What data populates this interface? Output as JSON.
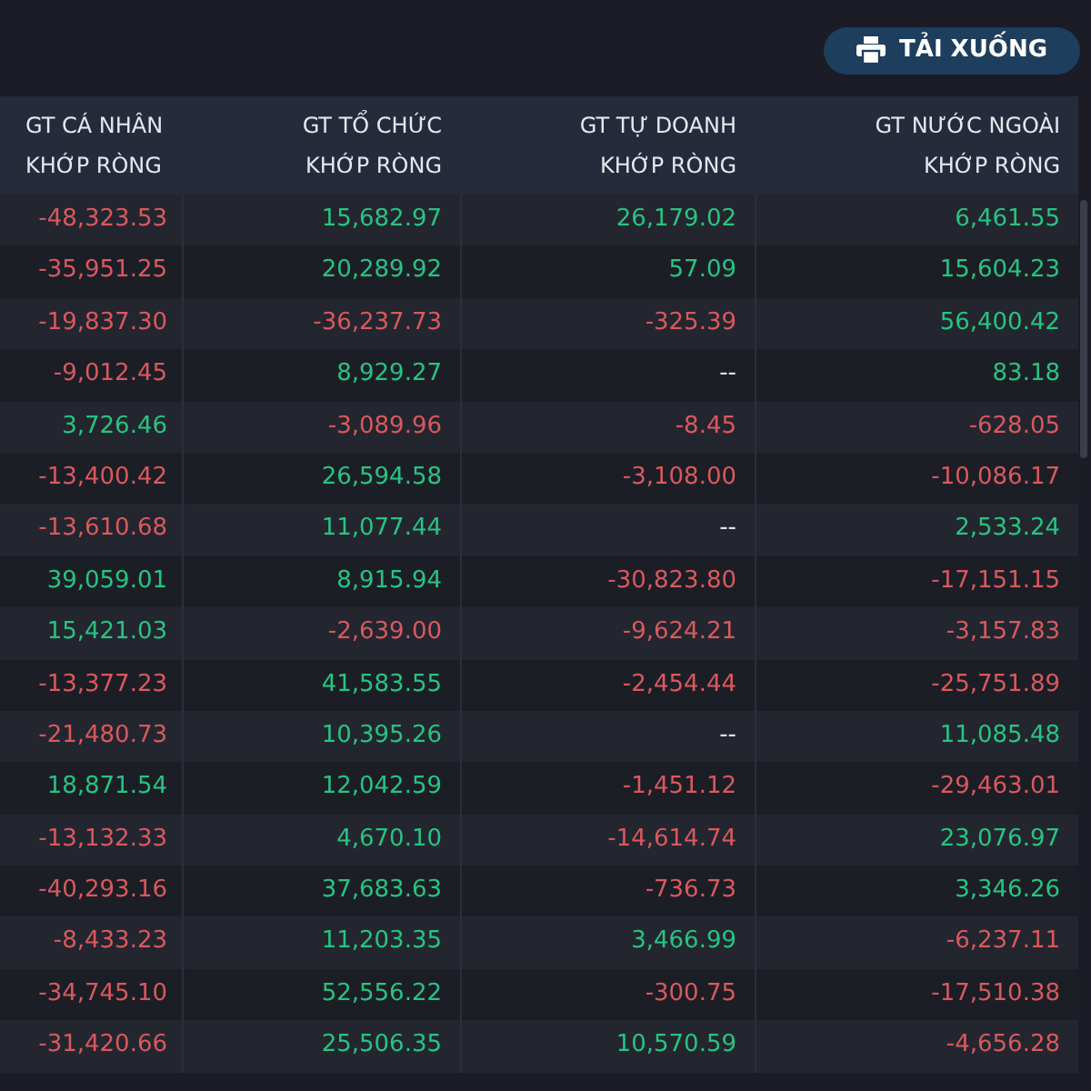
{
  "download_button": {
    "label": "TẢI XUỐNG"
  },
  "table": {
    "columns": [
      {
        "line1": "GT CÁ NHÂN",
        "line2": "KHỚP RÒNG"
      },
      {
        "line1": "GT TỔ CHỨC",
        "line2": "KHỚP RÒNG"
      },
      {
        "line1": "GT TỰ DOANH",
        "line2": "KHỚP RÒNG"
      },
      {
        "line1": "GT NƯỚC NGOÀI",
        "line2": "KHỚP RÒNG"
      }
    ],
    "rows": [
      [
        {
          "value": "-48,323.53",
          "color": "#d9595e"
        },
        {
          "value": "15,682.97",
          "color": "#27c481"
        },
        {
          "value": "26,179.02",
          "color": "#27c481"
        },
        {
          "value": "6,461.55",
          "color": "#27c481"
        }
      ],
      [
        {
          "value": "-35,951.25",
          "color": "#d9595e"
        },
        {
          "value": "20,289.92",
          "color": "#27c481"
        },
        {
          "value": "57.09",
          "color": "#27c481"
        },
        {
          "value": "15,604.23",
          "color": "#27c481"
        }
      ],
      [
        {
          "value": "-19,837.30",
          "color": "#d9595e"
        },
        {
          "value": "-36,237.73",
          "color": "#d9595e"
        },
        {
          "value": "-325.39",
          "color": "#d9595e"
        },
        {
          "value": "56,400.42",
          "color": "#27c481"
        }
      ],
      [
        {
          "value": "-9,012.45",
          "color": "#d9595e"
        },
        {
          "value": "8,929.27",
          "color": "#27c481"
        },
        {
          "value": "--",
          "color": "#e6e8ee"
        },
        {
          "value": "83.18",
          "color": "#27c481"
        }
      ],
      [
        {
          "value": "3,726.46",
          "color": "#27c481"
        },
        {
          "value": "-3,089.96",
          "color": "#d9595e"
        },
        {
          "value": "-8.45",
          "color": "#d9595e"
        },
        {
          "value": "-628.05",
          "color": "#d9595e"
        }
      ],
      [
        {
          "value": "-13,400.42",
          "color": "#d9595e"
        },
        {
          "value": "26,594.58",
          "color": "#27c481"
        },
        {
          "value": "-3,108.00",
          "color": "#d9595e"
        },
        {
          "value": "-10,086.17",
          "color": "#d9595e"
        }
      ],
      [
        {
          "value": "-13,610.68",
          "color": "#d9595e"
        },
        {
          "value": "11,077.44",
          "color": "#27c481"
        },
        {
          "value": "--",
          "color": "#e6e8ee"
        },
        {
          "value": "2,533.24",
          "color": "#27c481"
        }
      ],
      [
        {
          "value": "39,059.01",
          "color": "#27c481"
        },
        {
          "value": "8,915.94",
          "color": "#27c481"
        },
        {
          "value": "-30,823.80",
          "color": "#d9595e"
        },
        {
          "value": "-17,151.15",
          "color": "#d9595e"
        }
      ],
      [
        {
          "value": "15,421.03",
          "color": "#27c481"
        },
        {
          "value": "-2,639.00",
          "color": "#d9595e"
        },
        {
          "value": "-9,624.21",
          "color": "#d9595e"
        },
        {
          "value": "-3,157.83",
          "color": "#d9595e"
        }
      ],
      [
        {
          "value": "-13,377.23",
          "color": "#d9595e"
        },
        {
          "value": "41,583.55",
          "color": "#27c481"
        },
        {
          "value": "-2,454.44",
          "color": "#d9595e"
        },
        {
          "value": "-25,751.89",
          "color": "#d9595e"
        }
      ],
      [
        {
          "value": "-21,480.73",
          "color": "#d9595e"
        },
        {
          "value": "10,395.26",
          "color": "#27c481"
        },
        {
          "value": "--",
          "color": "#e6e8ee"
        },
        {
          "value": "11,085.48",
          "color": "#27c481"
        }
      ],
      [
        {
          "value": "18,871.54",
          "color": "#27c481"
        },
        {
          "value": "12,042.59",
          "color": "#27c481"
        },
        {
          "value": "-1,451.12",
          "color": "#d9595e"
        },
        {
          "value": "-29,463.01",
          "color": "#d9595e"
        }
      ],
      [
        {
          "value": "-13,132.33",
          "color": "#d9595e"
        },
        {
          "value": "4,670.10",
          "color": "#27c481"
        },
        {
          "value": "-14,614.74",
          "color": "#d9595e"
        },
        {
          "value": "23,076.97",
          "color": "#27c481"
        }
      ],
      [
        {
          "value": "-40,293.16",
          "color": "#d9595e"
        },
        {
          "value": "37,683.63",
          "color": "#27c481"
        },
        {
          "value": "-736.73",
          "color": "#d9595e"
        },
        {
          "value": "3,346.26",
          "color": "#27c481"
        }
      ],
      [
        {
          "value": "-8,433.23",
          "color": "#d9595e"
        },
        {
          "value": "11,203.35",
          "color": "#27c481"
        },
        {
          "value": "3,466.99",
          "color": "#27c481"
        },
        {
          "value": "-6,237.11",
          "color": "#d9595e"
        }
      ],
      [
        {
          "value": "-34,745.10",
          "color": "#d9595e"
        },
        {
          "value": "52,556.22",
          "color": "#27c481"
        },
        {
          "value": "-300.75",
          "color": "#d9595e"
        },
        {
          "value": "-17,510.38",
          "color": "#d9595e"
        }
      ],
      [
        {
          "value": "-31,420.66",
          "color": "#d9595e"
        },
        {
          "value": "25,506.35",
          "color": "#27c481"
        },
        {
          "value": "10,570.59",
          "color": "#27c481"
        },
        {
          "value": "-4,656.28",
          "color": "#d9595e"
        }
      ]
    ]
  }
}
